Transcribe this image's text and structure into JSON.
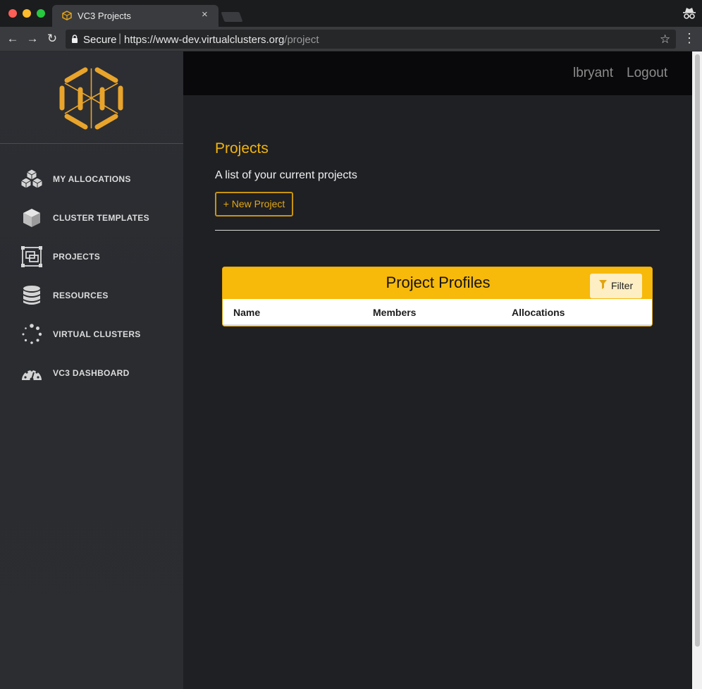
{
  "browser": {
    "tab_title": "VC3 Projects",
    "tab_close": "×",
    "secure_label": "Secure",
    "url_host": "https://www-dev.virtualclusters.org",
    "url_path": "/project",
    "separator": "|"
  },
  "topbar": {
    "user": "lbryant",
    "logout": "Logout"
  },
  "sidebar": {
    "items": [
      {
        "label": "MY ALLOCATIONS",
        "icon": "cubes-icon"
      },
      {
        "label": "CLUSTER TEMPLATES",
        "icon": "cube-icon"
      },
      {
        "label": "PROJECTS",
        "icon": "project-frame-icon"
      },
      {
        "label": "RESOURCES",
        "icon": "database-icon"
      },
      {
        "label": "VIRTUAL CLUSTERS",
        "icon": "spinner-icon"
      },
      {
        "label": "VC3 DASHBOARD",
        "icon": "dashboard-gauge-icon"
      }
    ]
  },
  "main": {
    "title": "Projects",
    "subtitle": "A list of your current projects",
    "new_button": "+ New Project",
    "table": {
      "title": "Project Profiles",
      "filter": "Filter",
      "columns": [
        "Name",
        "Members",
        "Allocations"
      ]
    }
  },
  "colors": {
    "accent": "#f7b90a",
    "sidebar_bg": "#2c2e33",
    "main_bg": "#1f2024"
  }
}
